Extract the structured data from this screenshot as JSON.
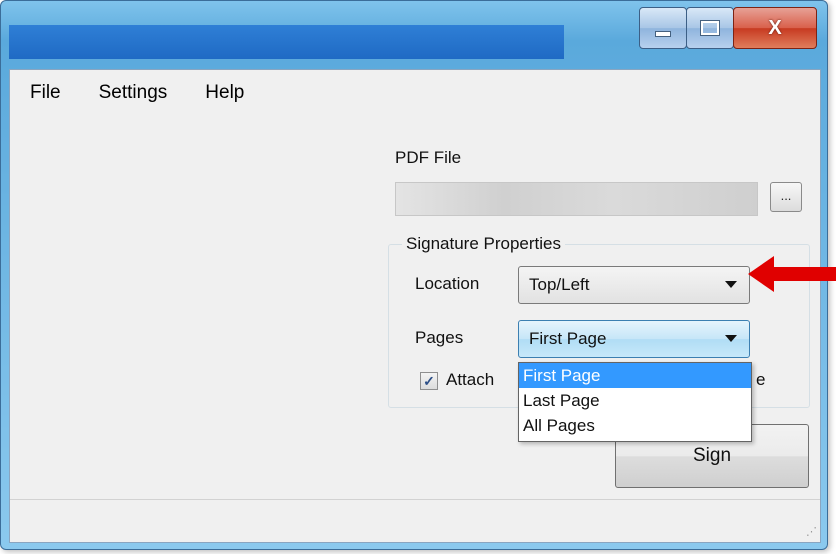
{
  "window": {
    "title": "",
    "buttons": {
      "minimize": "minimize-icon",
      "maximize": "maximize-icon",
      "close": "X"
    },
    "colors": {
      "titlebar": "#2f7fd6",
      "frame": "#5aa9dc",
      "close": "#c73a21"
    }
  },
  "menu": {
    "items": [
      "File",
      "Settings",
      "Help"
    ]
  },
  "pdf": {
    "label": "PDF File",
    "value": "",
    "browse_label": "..."
  },
  "signature": {
    "group_title": "Signature Properties",
    "location_label": "Location",
    "location_value": "Top/Left",
    "pages_label": "Pages",
    "pages_value": "First Page",
    "pages_options": [
      "First Page",
      "Last Page",
      "All Pages"
    ],
    "attach_label": "Attach",
    "attach_tail": "e",
    "attach_checked": true
  },
  "actions": {
    "sign_label": "Sign"
  },
  "annotation": {
    "arrow_color": "#e00000"
  },
  "accent": {
    "selection": "#3399ff"
  }
}
